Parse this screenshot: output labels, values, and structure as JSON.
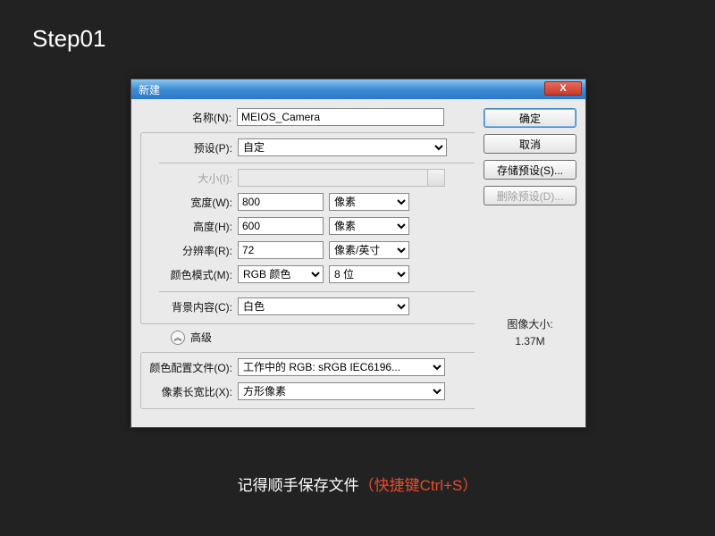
{
  "step_label": "Step01",
  "dialog": {
    "title": "新建",
    "close": "X",
    "name_label": "名称(N):",
    "name_value": "MEIOS_Camera",
    "preset_label": "预设(P):",
    "preset_value": "自定",
    "size_label": "大小(I):",
    "width_label": "宽度(W):",
    "width_value": "800",
    "width_unit": "像素",
    "height_label": "高度(H):",
    "height_value": "600",
    "height_unit": "像素",
    "res_label": "分辨率(R):",
    "res_value": "72",
    "res_unit": "像素/英寸",
    "mode_label": "颜色模式(M):",
    "mode_value": "RGB 颜色",
    "bits_value": "8 位",
    "bg_label": "背景内容(C):",
    "bg_value": "白色",
    "adv_label": "高级",
    "profile_label": "颜色配置文件(O):",
    "profile_value": "工作中的 RGB: sRGB IEC6196...",
    "aspect_label": "像素长宽比(X):",
    "aspect_value": "方形像素",
    "ok": "确定",
    "cancel": "取消",
    "save_preset": "存储预设(S)...",
    "delete_preset": "删除预设(D)...",
    "image_size_label": "图像大小:",
    "image_size_value": "1.37M"
  },
  "footer": {
    "msg": "记得顺手保存文件",
    "hint": "（快捷键Ctrl+S）"
  }
}
